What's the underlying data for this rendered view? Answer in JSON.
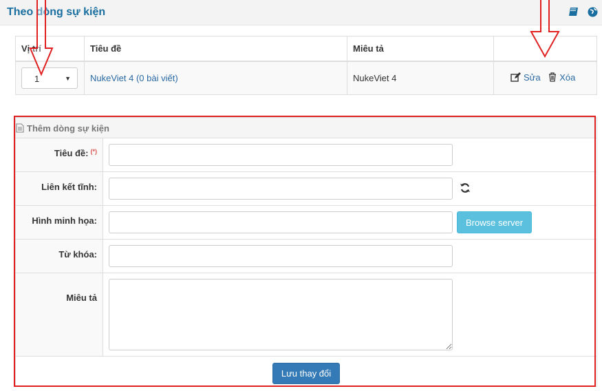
{
  "header": {
    "title": "Theo dòng sự kiện",
    "icons": [
      "book-icon",
      "globe-icon"
    ]
  },
  "list": {
    "columns": [
      "Vị trí",
      "Tiêu đề",
      "Miêu tả",
      ""
    ],
    "rows": [
      {
        "weight": "1",
        "title": "NukeViet 4 (0 bài viết)",
        "description": "NukeViet 4",
        "edit_label": "Sửa",
        "delete_label": "Xóa"
      }
    ]
  },
  "form": {
    "heading": "Thêm dòng sự kiện",
    "required_mark": "(*)",
    "title_label": "Tiêu đề:",
    "alias_label": "Liên kết tĩnh:",
    "image_label": "Hình minh họa:",
    "keywords_label": "Từ khóa:",
    "description_label": "Miêu tả",
    "browse_label": "Browse server",
    "submit_label": "Lưu thay đổi"
  },
  "colors": {
    "accent": "#1a6fa0",
    "link": "#2a6aa5",
    "primary_button": "#337ab7",
    "info_button": "#5bc0de",
    "annotation": "#e02020"
  }
}
